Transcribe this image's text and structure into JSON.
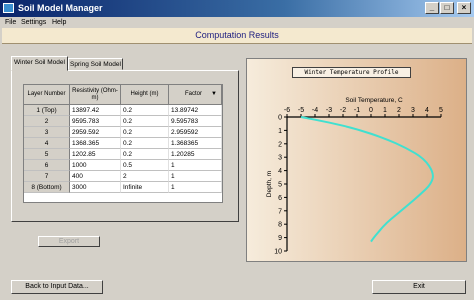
{
  "window": {
    "title": "Soil Model Manager",
    "minimize": "_",
    "maximize": "□",
    "close": "×"
  },
  "menu": [
    "File",
    "Settings",
    "Help"
  ],
  "header": {
    "title": "Computation Results"
  },
  "tabs": [
    "Winter Soil Model",
    "Spring Soil Model"
  ],
  "table": {
    "columns": [
      "Layer Number",
      "Resistivity (Ohm-m)",
      "Height (m)",
      "Factor"
    ],
    "sort_indicator": "▼",
    "rows": [
      [
        "1 (Top)",
        "13897.42",
        "0.2",
        "13.89742"
      ],
      [
        "2",
        "9595.783",
        "0.2",
        "9.595783"
      ],
      [
        "3",
        "2959.592",
        "0.2",
        "2.959592"
      ],
      [
        "4",
        "1368.365",
        "0.2",
        "1.368365"
      ],
      [
        "5",
        "1202.85",
        "0.2",
        "1.20285"
      ],
      [
        "6",
        "1000",
        "0.5",
        "1"
      ],
      [
        "7",
        "400",
        "2",
        "1"
      ],
      [
        "8 (Bottom)",
        "3000",
        "Infinite",
        "1"
      ]
    ]
  },
  "buttons": {
    "export": "Export",
    "back": "Back to Input Data...",
    "exit": "Exit"
  },
  "colors": {
    "curve": "#40e0d0"
  },
  "chart_data": {
    "type": "line",
    "title": "Winter Temperature Profile",
    "xlabel": "Soil Temperature, C",
    "ylabel": "Depth, m",
    "xlim": [
      -6,
      5
    ],
    "ylim": [
      0,
      10
    ],
    "y_inverted": true,
    "x_axis_position": "top",
    "x_ticks": [
      -6,
      -5,
      -4,
      -3,
      -2,
      -1,
      0,
      1,
      2,
      3,
      4,
      5
    ],
    "y_ticks": [
      0,
      1,
      2,
      3,
      4,
      5,
      6,
      7,
      8,
      9,
      10
    ],
    "series": [
      {
        "x": [
          -5,
          -3,
          -1,
          1,
          2.5,
          3.8,
          4.5,
          4.3,
          3.5,
          2.6,
          1.8,
          1.1,
          0.6,
          0.2,
          0.0
        ],
        "y": [
          0,
          0.4,
          0.9,
          1.6,
          2.3,
          3.1,
          4.2,
          5.0,
          5.8,
          6.6,
          7.3,
          7.9,
          8.5,
          9.0,
          9.3
        ]
      }
    ]
  }
}
